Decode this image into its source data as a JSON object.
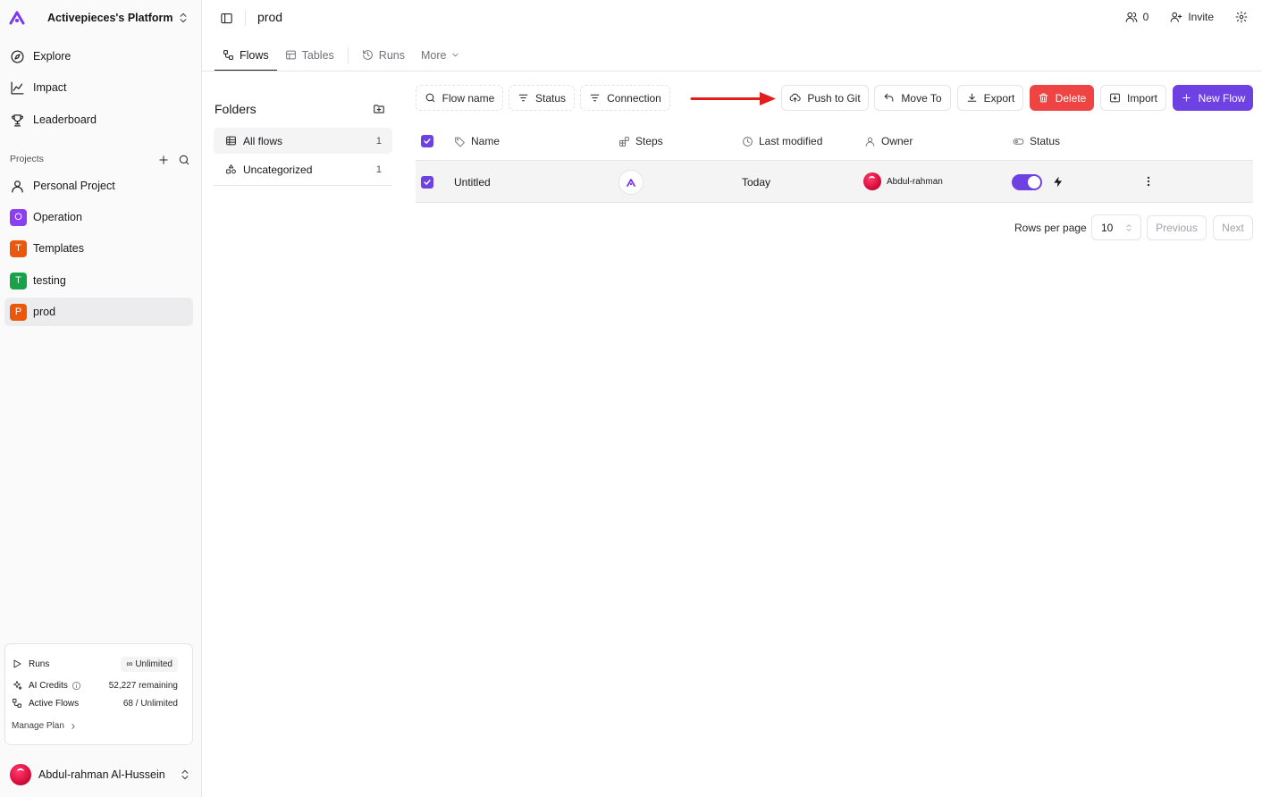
{
  "colors": {
    "accent": "#6e41e2",
    "danger": "#ef4444",
    "arrow": "#e11d1d"
  },
  "platform": {
    "name": "Activepieces's Platform"
  },
  "nav": {
    "explore": "Explore",
    "impact": "Impact",
    "leaderboard": "Leaderboard"
  },
  "projects": {
    "label": "Projects",
    "items": [
      {
        "label": "Personal Project",
        "icon": "user-icon"
      },
      {
        "label": "Operation",
        "letter": "O",
        "color": "#8b3ff0"
      },
      {
        "label": "Templates",
        "letter": "T",
        "color": "#ea580c"
      },
      {
        "label": "testing",
        "letter": "T",
        "color": "#16a34a"
      },
      {
        "label": "prod",
        "letter": "P",
        "color": "#ea580c"
      }
    ]
  },
  "usage": {
    "runs_label": "Runs",
    "runs_value": "∞ Unlimited",
    "ai_label": "AI Credits",
    "ai_value": "52,227 remaining",
    "flows_label": "Active Flows",
    "flows_value": "68 / Unlimited",
    "manage": "Manage Plan"
  },
  "user": {
    "name": "Abdul-rahman Al-Hussein"
  },
  "topbar": {
    "breadcrumb": "prod",
    "members_count": "0",
    "invite": "Invite"
  },
  "tabs": {
    "flows": "Flows",
    "tables": "Tables",
    "runs": "Runs",
    "more": "More"
  },
  "folders": {
    "title": "Folders",
    "items": [
      {
        "label": "All flows",
        "count": "1"
      },
      {
        "label": "Uncategorized",
        "count": "1"
      }
    ]
  },
  "toolbar": {
    "flow_name": "Flow name",
    "status": "Status",
    "connection": "Connection",
    "push_to_git": "Push to Git",
    "move_to": "Move To",
    "export": "Export",
    "delete": "Delete",
    "import": "Import",
    "new_flow": "New Flow"
  },
  "table": {
    "columns": {
      "name": "Name",
      "steps": "Steps",
      "last_modified": "Last modified",
      "owner": "Owner",
      "status": "Status"
    },
    "rows": [
      {
        "name": "Untitled",
        "last_modified": "Today",
        "owner": "Abdul-rahman",
        "enabled": true,
        "selected": true
      }
    ]
  },
  "pagination": {
    "rows_per_page_label": "Rows per page",
    "rows_per_page": "10",
    "previous": "Previous",
    "next": "Next"
  }
}
